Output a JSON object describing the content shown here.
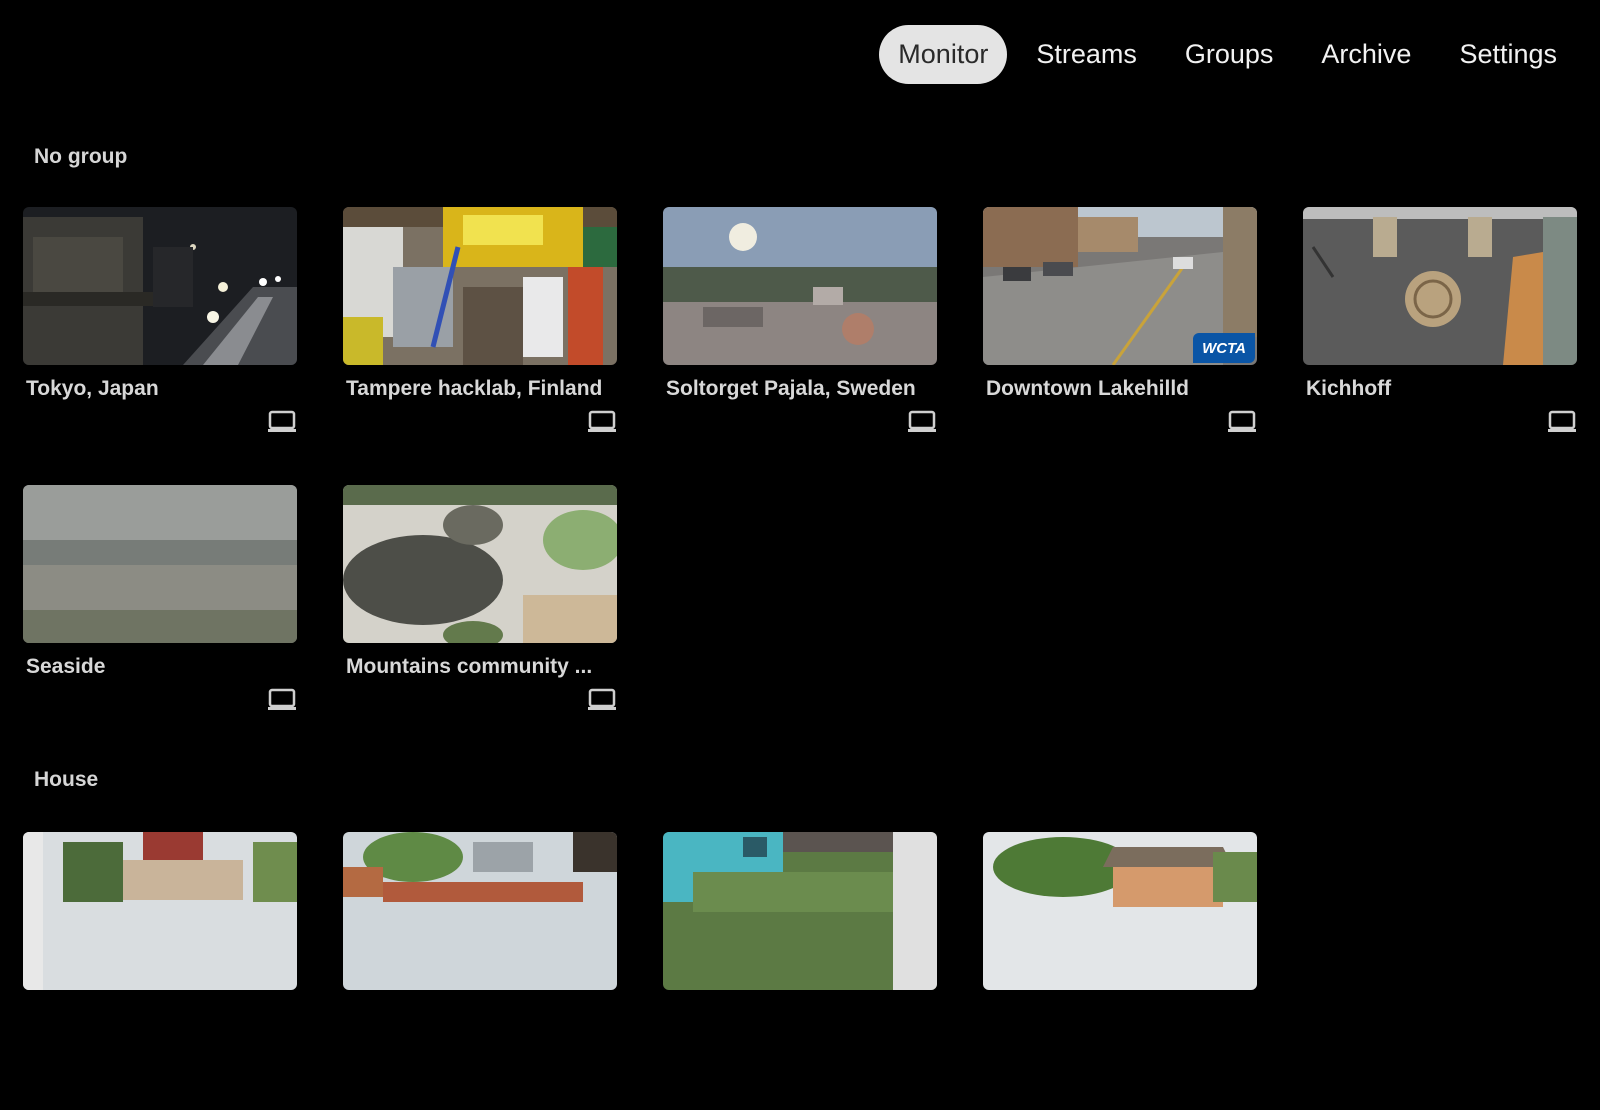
{
  "nav": {
    "tabs": [
      {
        "label": "Monitor",
        "active": true
      },
      {
        "label": "Streams",
        "active": false
      },
      {
        "label": "Groups",
        "active": false
      },
      {
        "label": "Archive",
        "active": false
      },
      {
        "label": "Settings",
        "active": false
      }
    ]
  },
  "groups": [
    {
      "title": "No group",
      "cameras": [
        {
          "name": "Tokyo, Japan",
          "icon": "screen-icon"
        },
        {
          "name": "Tampere hacklab, Finland",
          "icon": "screen-icon"
        },
        {
          "name": "Soltorget Pajala, Sweden",
          "icon": "screen-icon"
        },
        {
          "name": "Downtown Lakehilld",
          "icon": "screen-icon",
          "badge": "WCTA"
        },
        {
          "name": "Kichhoff",
          "icon": "screen-icon"
        },
        {
          "name": "Seaside",
          "icon": "screen-icon"
        },
        {
          "name": "Mountains community ...",
          "icon": "screen-icon"
        }
      ]
    },
    {
      "title": "House",
      "cameras": [
        {
          "name": ""
        },
        {
          "name": ""
        },
        {
          "name": ""
        },
        {
          "name": ""
        }
      ]
    }
  ],
  "colors": {
    "background": "#000000",
    "active_tab_bg": "#e4e4e4",
    "badge": "#0a55a6"
  }
}
